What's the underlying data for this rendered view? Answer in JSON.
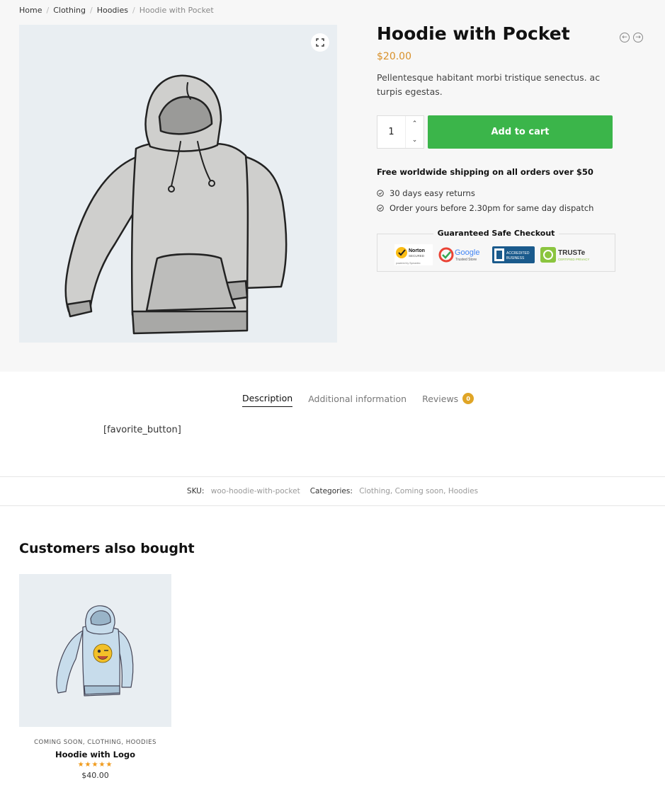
{
  "breadcrumb": {
    "home": "Home",
    "clothing": "Clothing",
    "hoodies": "Hoodies",
    "current": "Hoodie with Pocket"
  },
  "product": {
    "title": "Hoodie with Pocket",
    "price": "$20.00",
    "short_description": "Pellentesque habitant morbi tristique senectus. ac turpis egestas.",
    "quantity": "1",
    "add_to_cart_label": "Add to cart",
    "image_icon": "hoodie-grey-illustration"
  },
  "shipping": {
    "headline": "Free worldwide shipping on all orders over $50",
    "items": [
      "30 days easy returns",
      "Order yours before 2.30pm for same day dispatch"
    ]
  },
  "safe_checkout": {
    "title": "Guaranteed Safe Checkout",
    "badges": {
      "norton": "Norton",
      "norton_sub": "SECURED",
      "norton_foot": "powered by Symantec",
      "google": "Google",
      "google_sub": "Trusted Store",
      "bbb_line1": "ACCREDITED",
      "bbb_line2": "BUSINESS",
      "truste": "TRUSTe",
      "truste_sub": "CERTIFIED PRIVACY"
    }
  },
  "tabs": {
    "description": "Description",
    "additional": "Additional information",
    "reviews": "Reviews",
    "reviews_count": "0"
  },
  "tab_content": "[favorite_button]",
  "meta": {
    "sku_label": "SKU:",
    "sku_value": "woo-hoodie-with-pocket",
    "categories_label": "Categories:",
    "categories": [
      "Clothing",
      "Coming soon",
      "Hoodies"
    ]
  },
  "related": {
    "title": "Customers also bought",
    "products": [
      {
        "categories": "Coming soon, Clothing, Hoodies",
        "title": "Hoodie with Logo",
        "stars": "★★★★★",
        "rating": 5,
        "price": "$40.00"
      }
    ]
  },
  "colors": {
    "accent_price": "#d8902a",
    "add_to_cart": "#3bb54a",
    "badge": "#e0a526"
  }
}
